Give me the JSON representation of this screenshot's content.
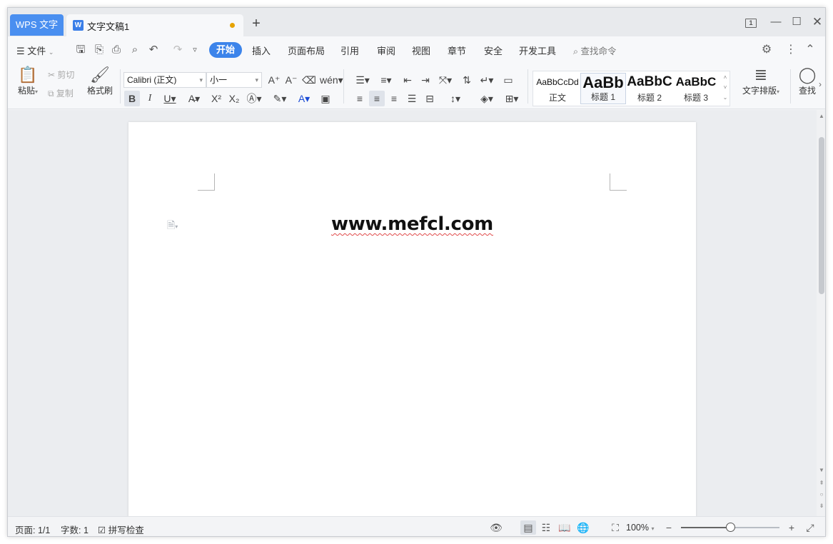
{
  "titlebar": {
    "app_tab": "WPS 文字",
    "doc_tab": "文字文稿1",
    "new_tab": "+",
    "workspace_badge": "1"
  },
  "menubar": {
    "file": "文件",
    "tabs": [
      "开始",
      "插入",
      "页面布局",
      "引用",
      "审阅",
      "视图",
      "章节",
      "安全",
      "开发工具"
    ],
    "active_tab": "开始",
    "search_placeholder": "查找命令"
  },
  "ribbon": {
    "paste": "粘贴",
    "cut": "剪切",
    "copy": "复制",
    "format_painter": "格式刷",
    "font_name": "Calibri (正文)",
    "font_size": "小一",
    "styles": [
      {
        "sample": "AaBbCcDd",
        "name": "正文"
      },
      {
        "sample": "AaBb",
        "name": "标题 1"
      },
      {
        "sample": "AaBbC",
        "name": "标题 2"
      },
      {
        "sample": "AaBbC",
        "name": "标题 3"
      }
    ],
    "text_layout": "文字排版",
    "find": "查找"
  },
  "document": {
    "content": "www.mefcl.com"
  },
  "statusbar": {
    "page": "页面: 1/1",
    "word_count": "字数: 1",
    "spell_check": "拼写检查",
    "zoom": "100%",
    "zoom_level": 0.5
  },
  "colors": {
    "accent": "#3c84ea",
    "app_tab": "#4a8ff0",
    "unsaved_dot": "#e6a300",
    "squiggle": "#e04a4a"
  }
}
